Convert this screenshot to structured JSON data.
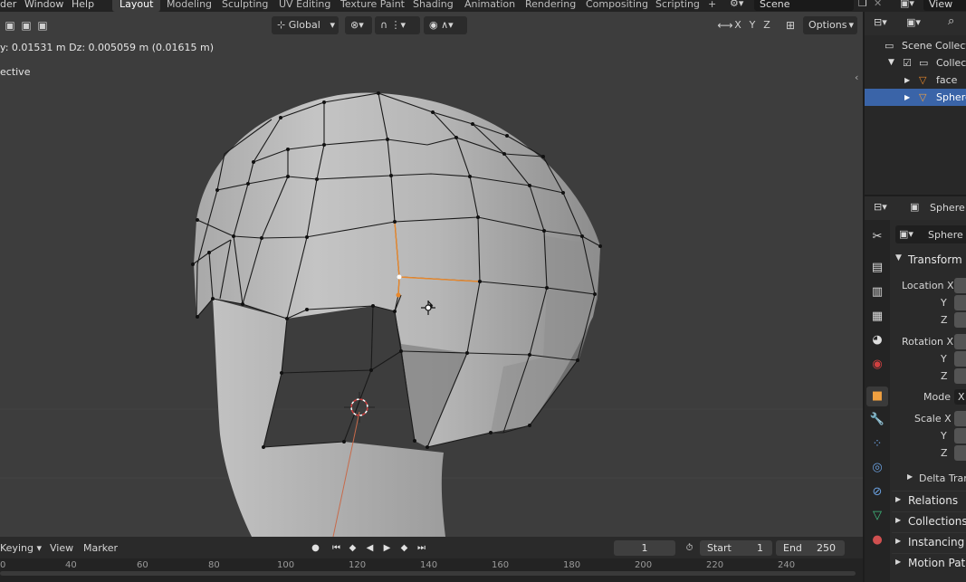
{
  "menu": {
    "items": [
      "der",
      "Window",
      "Help"
    ]
  },
  "workspaces": {
    "tabs": [
      "Layout",
      "Modeling",
      "Sculpting",
      "UV Editing",
      "Texture Paint",
      "Shading",
      "Animation",
      "Rendering",
      "Compositing",
      "Scripting"
    ],
    "active": "Layout",
    "add_label": "+"
  },
  "scene": {
    "name": "Scene"
  },
  "view_layer": {
    "label": "View Lay"
  },
  "viewport": {
    "transform_orientation": "Global",
    "axes": [
      "X",
      "Y",
      "Z"
    ],
    "options_label": "Options",
    "operator_info": "y: 0.01531 m  Dz: 0.005059 m (0.01615 m)",
    "view_name": "ective"
  },
  "timeline": {
    "keying_label": "Keying",
    "view_label": "View",
    "marker_label": "Marker",
    "current_frame": "1",
    "start_label": "Start",
    "start_value": "1",
    "end_label": "End",
    "end_value": "250",
    "ruler_ticks": [
      "0",
      "40",
      "60",
      "80",
      "100",
      "120",
      "140",
      "160",
      "180",
      "200",
      "220",
      "240"
    ]
  },
  "outliner": {
    "rows": [
      {
        "label": "Scene Collectio",
        "selected": false
      },
      {
        "label": "Collecti",
        "selected": false
      },
      {
        "label": "face",
        "selected": false
      },
      {
        "label": "Sphere",
        "selected": true
      }
    ]
  },
  "properties": {
    "header_object": "Sphere",
    "object_name": "Sphere",
    "transform_title": "Transform",
    "location_label": "Location X",
    "rotation_label": "Rotation X",
    "y_label": "Y",
    "z_label": "Z",
    "mode_label": "Mode",
    "mode_value": "X",
    "scale_label": "Scale X",
    "delta_label": "Delta Trans",
    "panels": [
      "Relations",
      "Collections",
      "Instancing",
      "Motion Paths"
    ]
  },
  "colors": {
    "viewport_bg": "#3d3d3d",
    "mesh_surface": "#b8b8b8",
    "selection_orange": "#e8882c",
    "selected_row": "#3a64a8"
  }
}
